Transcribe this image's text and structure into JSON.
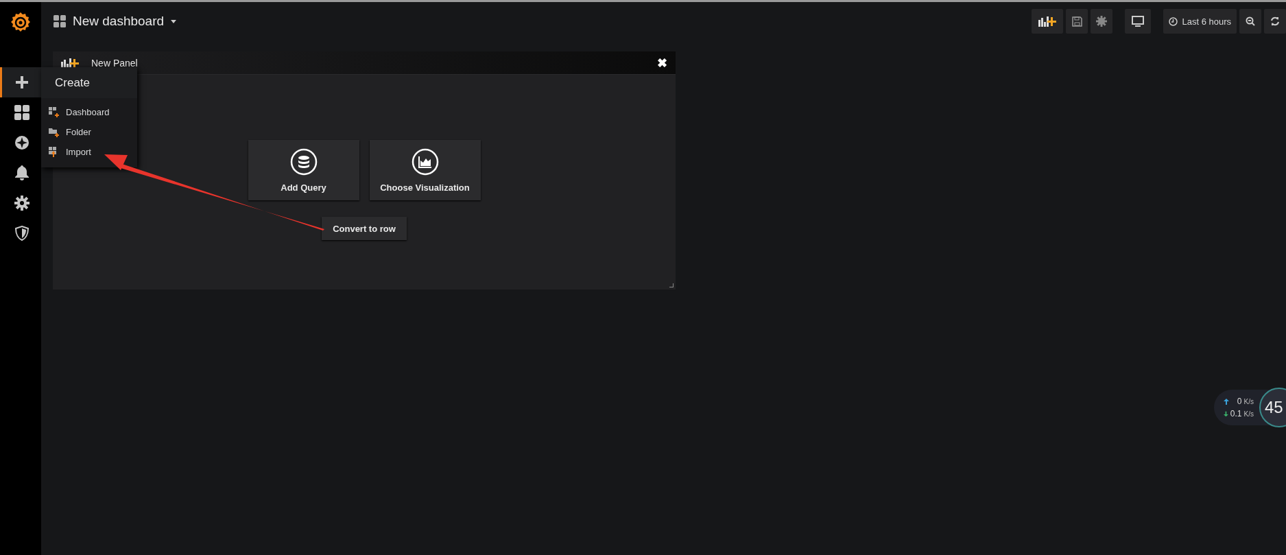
{
  "sidebar": {
    "items": [
      {
        "kind": "create",
        "selected": true
      },
      {
        "kind": "dashboards",
        "selected": false
      },
      {
        "kind": "explore",
        "selected": false
      },
      {
        "kind": "alerting",
        "selected": false
      },
      {
        "kind": "configuration",
        "selected": false
      },
      {
        "kind": "server-admin",
        "selected": false
      }
    ]
  },
  "topbar": {
    "title": "New dashboard",
    "time_range": "Last 6 hours"
  },
  "create_menu": {
    "title": "Create",
    "items": [
      {
        "kind": "dashboard",
        "label": "Dashboard"
      },
      {
        "kind": "folder",
        "label": "Folder"
      },
      {
        "kind": "import",
        "label": "Import"
      }
    ]
  },
  "panel": {
    "title": "New Panel",
    "close_glyph": "✖",
    "actions": [
      {
        "kind": "query",
        "label": "Add Query"
      },
      {
        "kind": "visualization",
        "label": "Choose Visualization"
      }
    ],
    "convert_label": "Convert to row"
  },
  "network_widget": {
    "upload_value": "0",
    "upload_unit": "K/s",
    "download_value": "0.1",
    "download_unit": "K/s",
    "gauge": "45"
  }
}
